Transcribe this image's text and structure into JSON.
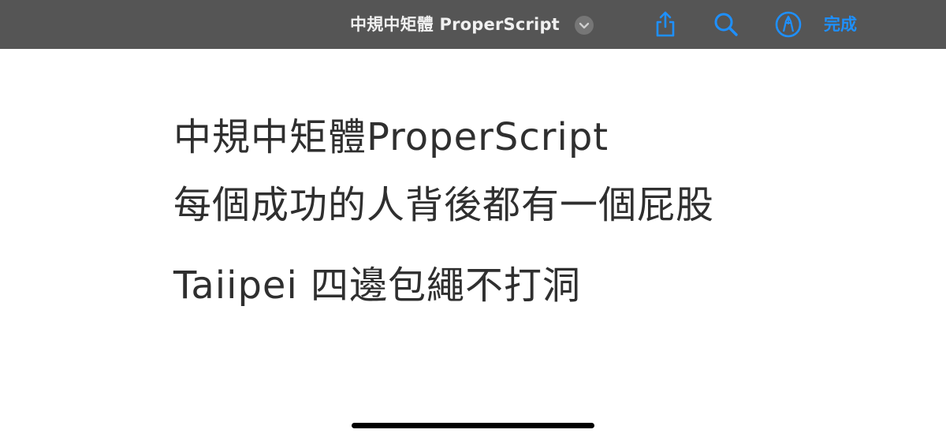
{
  "toolbar": {
    "title": "中規中矩體 ProperScript",
    "title_menu_icon": "chevron-down-icon",
    "share_icon": "share-icon",
    "search_icon": "search-icon",
    "markup_icon": "markup-pen-icon",
    "done_label": "完成",
    "accent_color": "#1e90ff",
    "background_color": "#555555"
  },
  "document": {
    "lines": [
      "中規中矩體ProperScript",
      "每個成功的人背後都有一個屁股",
      "Taiipei 四邊包繩不打洞"
    ]
  }
}
